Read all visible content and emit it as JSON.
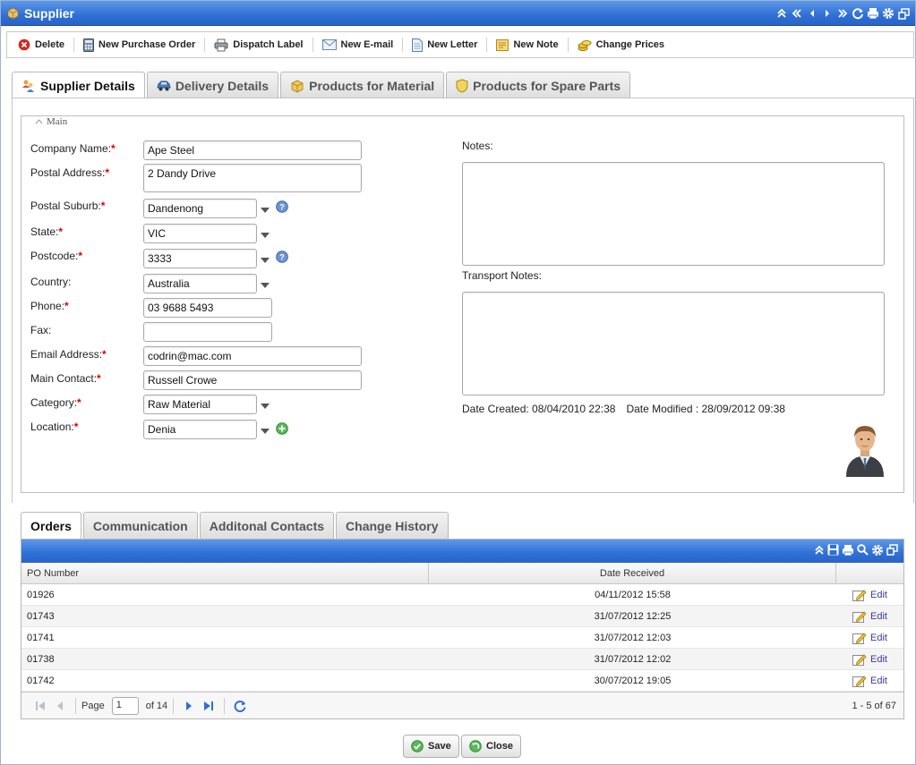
{
  "window": {
    "title": "Supplier"
  },
  "toolbar": {
    "delete": "Delete",
    "new_purchase_order": "New Purchase Order",
    "dispatch_label": "Dispatch Label",
    "new_email": "New E-mail",
    "new_letter": "New Letter",
    "new_note": "New Note",
    "change_prices": "Change Prices"
  },
  "tabs": [
    "Supplier Details",
    "Delivery Details",
    "Products for Material",
    "Products for Spare Parts"
  ],
  "section": {
    "legend": "Main"
  },
  "form": {
    "company_name": {
      "label": "Company Name:",
      "value": "Ape Steel"
    },
    "postal_address": {
      "label": "Postal Address:",
      "value": "2 Dandy Drive"
    },
    "postal_suburb": {
      "label": "Postal Suburb:",
      "value": "Dandenong"
    },
    "state": {
      "label": "State:",
      "value": "VIC"
    },
    "postcode": {
      "label": "Postcode:",
      "value": "3333"
    },
    "country": {
      "label": "Country:",
      "value": "Australia"
    },
    "phone": {
      "label": "Phone:",
      "value": "03 9688 5493"
    },
    "fax": {
      "label": "Fax:",
      "value": ""
    },
    "email": {
      "label": "Email Address:",
      "value": "codrin@mac.com"
    },
    "main_contact": {
      "label": "Main Contact:",
      "value": "Russell Crowe"
    },
    "category": {
      "label": "Category:",
      "value": "Raw Material"
    },
    "location": {
      "label": "Location:",
      "value": "Denia"
    },
    "required_mark": "*"
  },
  "notes": {
    "notes_label": "Notes:",
    "notes_value": "",
    "transport_label": "Transport Notes:",
    "transport_value": "",
    "date_created": "Date Created: 08/04/2010 22:38",
    "date_modified": "Date Modified : 28/09/2012 09:38"
  },
  "bottom_tabs": [
    "Orders",
    "Communication",
    "Additonal Contacts",
    "Change History"
  ],
  "grid": {
    "columns": [
      "PO Number",
      "Date Received",
      ""
    ],
    "edit_label": "Edit",
    "rows": [
      {
        "po": "01926",
        "date": "04/11/2012 15:58"
      },
      {
        "po": "01743",
        "date": "31/07/2012 12:25"
      },
      {
        "po": "01741",
        "date": "31/07/2012 12:03"
      },
      {
        "po": "01738",
        "date": "31/07/2012 12:02"
      },
      {
        "po": "01742",
        "date": "30/07/2012 19:05"
      }
    ]
  },
  "pager": {
    "page_label": "Page",
    "page_value": "1",
    "of_label": "of 14",
    "count": "1 - 5 of 67"
  },
  "footer": {
    "save": "Save",
    "close": "Close"
  },
  "colors": {
    "titlebar": "#2f6fd6",
    "required": "#dd0000",
    "link": "#3a3a9a"
  }
}
